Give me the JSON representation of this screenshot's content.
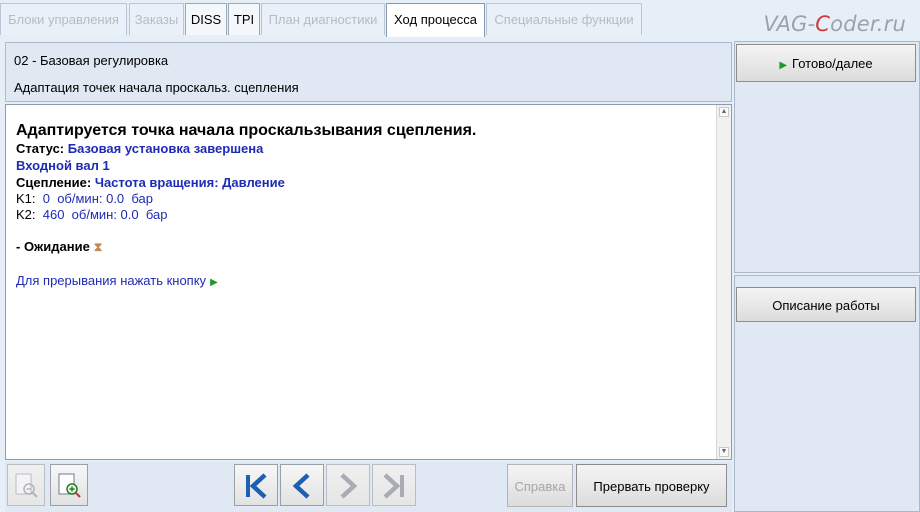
{
  "tabs": [
    {
      "label": "Блоки управления",
      "state": "disabled"
    },
    {
      "label": "Заказы",
      "state": "disabled"
    },
    {
      "label": "DISS",
      "state": "enabled"
    },
    {
      "label": "TPI",
      "state": "enabled"
    },
    {
      "label": "План диагностики",
      "state": "disabled"
    },
    {
      "label": "Ход процесса",
      "state": "active"
    },
    {
      "label": "Специальные функции",
      "state": "disabled"
    }
  ],
  "watermark": {
    "prefix": "VAG-",
    "highlight": "C",
    "suffix": "oder.ru"
  },
  "header": {
    "line1": "02 - Базовая регулировка",
    "line2": "Адаптация точек начала проскальз. сцепления"
  },
  "content": {
    "title": "Адаптируется точка начала проскальзывания сцепления.",
    "status_label": "Статус:",
    "status_value": "Базовая установка завершена",
    "input_shaft": "Входной вал 1",
    "clutch_label": "Сцепление:",
    "clutch_value": "Частота вращения: Давление",
    "k1_label": "K1:",
    "k1_value": "0  об/мин: 0.0  бар",
    "k2_label": "K2:",
    "k2_value": "460  об/мин: 0.0  бар",
    "waiting": "- Ожидание",
    "abort_hint": "Для прерывания нажать кнопку"
  },
  "right": {
    "done_button": "Готово/далее",
    "description_button": "Описание работы"
  },
  "toolbar": {
    "help_button": "Справка",
    "abort_button": "Прервать проверку"
  },
  "colors": {
    "accent_blue": "#1e2bb5",
    "go_green": "#1e9b1e"
  }
}
